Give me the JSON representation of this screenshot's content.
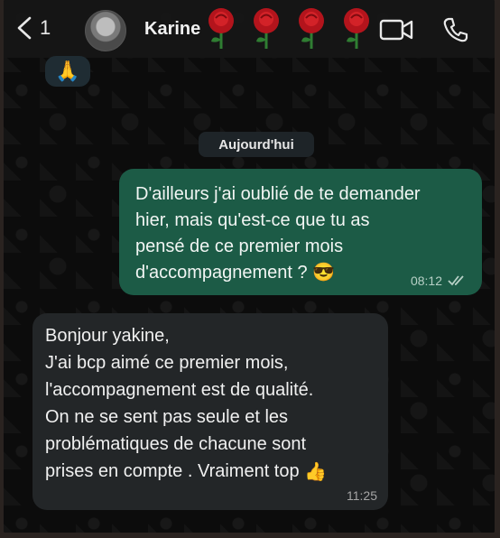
{
  "header": {
    "back_count": "1",
    "contact_name": "Karine",
    "icons": [
      "chevron-left-icon",
      "video-icon",
      "phone-icon"
    ]
  },
  "previous_message": {
    "emoji": "🙏"
  },
  "date_chip": "Aujourd'hui",
  "messages": [
    {
      "direction": "outgoing",
      "text": "D'ailleurs j'ai oublié de te demander\nhier, mais qu'est-ce que tu as\npensé de ce premier mois\nd'accompagnement ?",
      "emoji": "😎",
      "time": "08:12",
      "status": "read"
    },
    {
      "direction": "incoming",
      "text": "Bonjour yakine,\nJ'ai bcp aimé ce premier mois,\nl'accompagnement est de qualité.\nOn ne se sent pas seule et les\nproblématiques de chacune sont\nprises en compte . Vraiment top",
      "emoji": "👍",
      "time": "11:25"
    }
  ],
  "colors": {
    "outgoing_bubble": "#1c5b46",
    "incoming_bubble": "#232628",
    "background": "#0b0b0b"
  }
}
